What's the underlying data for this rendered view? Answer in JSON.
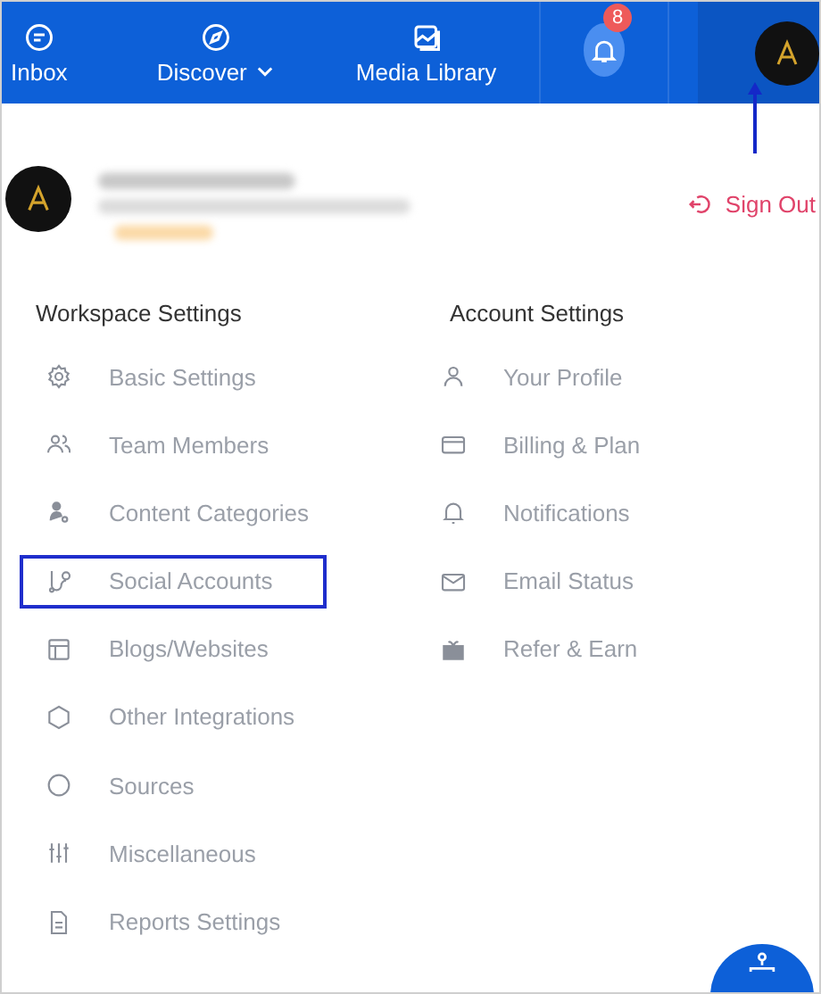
{
  "nav": {
    "items": [
      {
        "label": "Inbox",
        "kind": "chat",
        "dropdown": false
      },
      {
        "label": "Discover",
        "kind": "compass",
        "dropdown": true
      },
      {
        "label": "Media Library",
        "kind": "image",
        "dropdown": false
      }
    ],
    "notifications": {
      "count": "8"
    }
  },
  "profile": {
    "sign_out": "Sign Out"
  },
  "sections": [
    {
      "title": "Workspace Settings",
      "items": [
        {
          "label": "Basic Settings",
          "kind": "gear",
          "highlighted": false
        },
        {
          "label": "Team Members",
          "kind": "users",
          "highlighted": false
        },
        {
          "label": "Content Categories",
          "kind": "person-tag",
          "highlighted": false
        },
        {
          "label": "Social Accounts",
          "kind": "branch",
          "highlighted": true
        },
        {
          "label": "Blogs/Websites",
          "kind": "layout",
          "highlighted": false
        },
        {
          "label": "Other Integrations",
          "kind": "hexagon",
          "highlighted": false
        },
        {
          "label": "Sources",
          "kind": "circle",
          "highlighted": false
        },
        {
          "label": "Miscellaneous",
          "kind": "sliders",
          "highlighted": false
        },
        {
          "label": "Reports Settings",
          "kind": "document",
          "highlighted": false
        }
      ]
    },
    {
      "title": "Account Settings",
      "items": [
        {
          "label": "Your Profile",
          "kind": "user",
          "highlighted": false
        },
        {
          "label": "Billing & Plan",
          "kind": "card",
          "highlighted": false
        },
        {
          "label": "Notifications",
          "kind": "bell",
          "highlighted": false
        },
        {
          "label": "Email Status",
          "kind": "mail",
          "highlighted": false
        },
        {
          "label": "Refer & Earn",
          "kind": "gift",
          "highlighted": false
        }
      ]
    }
  ]
}
